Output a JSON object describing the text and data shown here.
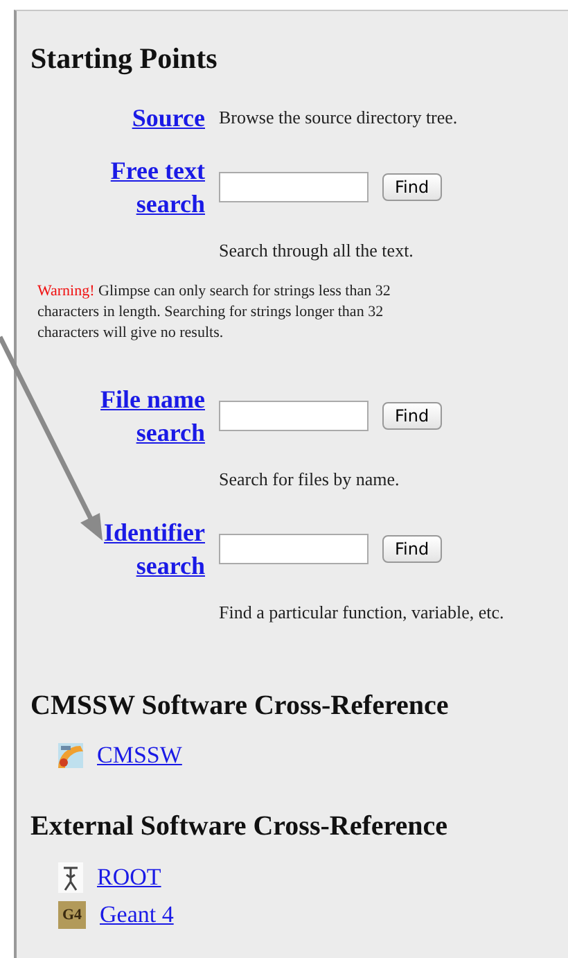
{
  "sections": [
    {
      "kind": "search",
      "title": "Starting Points",
      "rows": [
        {
          "kind": "link",
          "link": "Source",
          "description": "Browse the source directory tree."
        },
        {
          "kind": "search",
          "link": "Free text search",
          "button": "Find",
          "description": "Search through all the text.",
          "warning": {
            "label": "Warning!",
            "text": "Glimpse can only search for strings less than 32 characters in length. Searching for strings longer than 32 characters will give no results."
          }
        },
        {
          "kind": "search",
          "link": "File name search",
          "button": "Find",
          "description": "Search for files by name."
        },
        {
          "kind": "search",
          "link": "Identifier search",
          "button": "Find",
          "description": "Find a particular function, variable, etc."
        }
      ]
    },
    {
      "kind": "links",
      "title": "CMSSW Software Cross-Reference",
      "links": [
        {
          "kind": "cmssw",
          "label": "CMSSW"
        }
      ]
    },
    {
      "kind": "links",
      "title": "External Software Cross-Reference",
      "links": [
        {
          "kind": "root",
          "label": "ROOT"
        },
        {
          "kind": "geant",
          "label": "Geant 4",
          "icon_text": "G4"
        }
      ]
    }
  ]
}
